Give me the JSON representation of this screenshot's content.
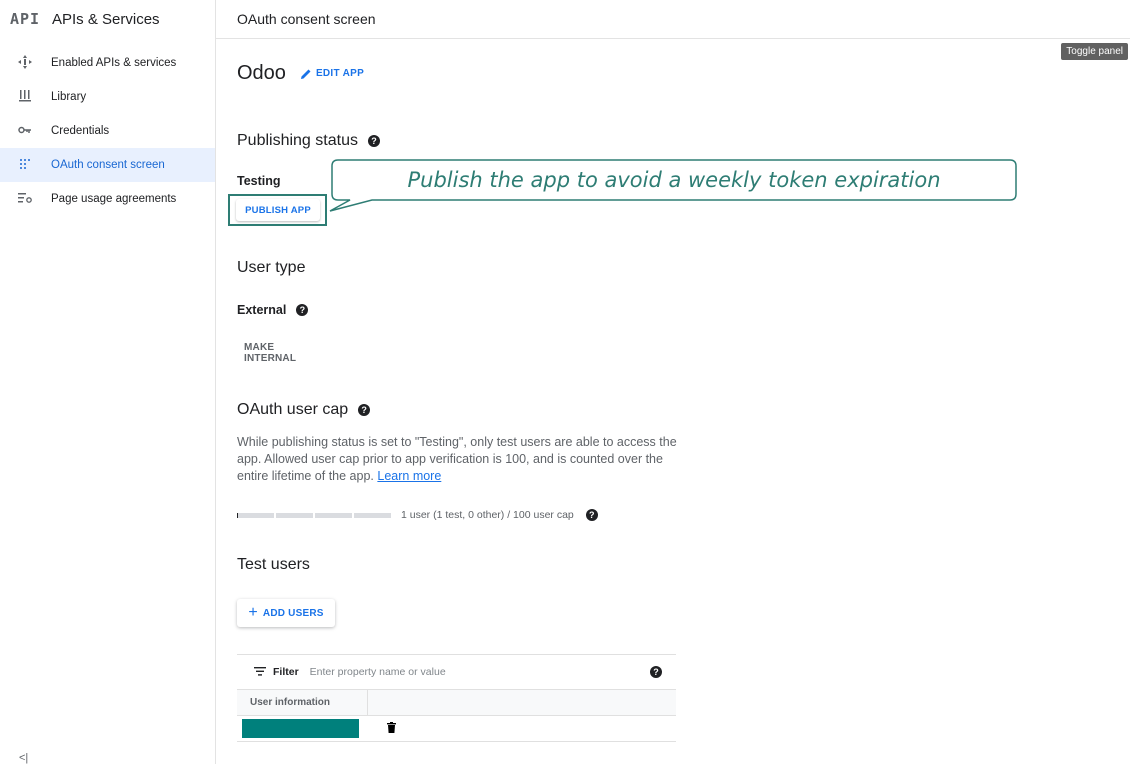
{
  "brand": {
    "logo": "API",
    "title": "APIs & Services"
  },
  "header": {
    "title": "OAuth consent screen"
  },
  "tooltip": "Toggle panel",
  "sidebar": {
    "items": [
      {
        "label": "Enabled APIs & services",
        "icon": "enabled-apis-icon",
        "active": false
      },
      {
        "label": "Library",
        "icon": "library-icon",
        "active": false
      },
      {
        "label": "Credentials",
        "icon": "key-icon",
        "active": false
      },
      {
        "label": "OAuth consent screen",
        "icon": "consent-icon",
        "active": true
      },
      {
        "label": "Page usage agreements",
        "icon": "settings-list-icon",
        "active": false
      }
    ],
    "collapse": "<|"
  },
  "app": {
    "name": "Odoo",
    "edit_label": "EDIT APP"
  },
  "publishing": {
    "title": "Publishing status",
    "status": "Testing",
    "publish_label": "PUBLISH APP"
  },
  "callout": {
    "text": "Publish the app to avoid a weekly token expiration",
    "color": "#2e7d74"
  },
  "user_type": {
    "title": "User type",
    "value": "External",
    "make_internal_label": "MAKE INTERNAL"
  },
  "user_cap": {
    "title": "OAuth user cap",
    "description": "While publishing status is set to \"Testing\", only test users are able to access the app. Allowed user cap prior to app verification is 100, and is counted over the entire lifetime of the app.",
    "learn_more": "Learn more",
    "usage_text": "1 user (1 test, 0 other) / 100 user cap",
    "used": 1,
    "cap": 100
  },
  "test_users": {
    "title": "Test users",
    "add_label": "ADD USERS",
    "filter_label": "Filter",
    "filter_placeholder": "Enter property name or value",
    "column_header": "User information"
  },
  "colors": {
    "accent": "#1a73e8",
    "active_bg": "#e8f0fe",
    "highlight": "#2e7d74",
    "redaction": "#00807c"
  }
}
